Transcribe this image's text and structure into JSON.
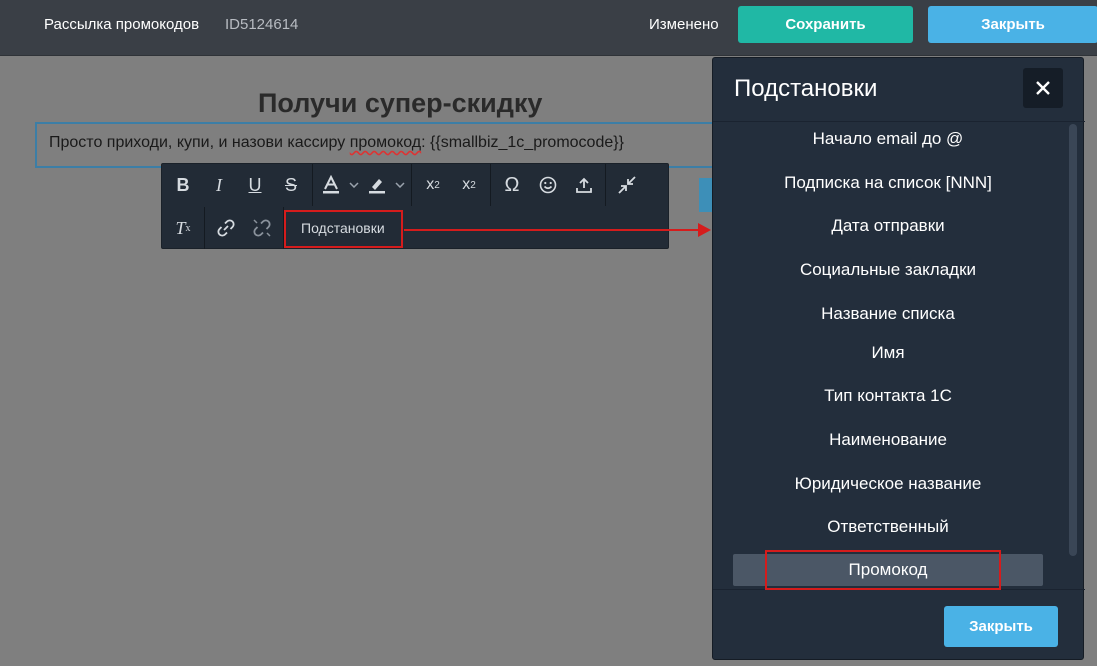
{
  "header": {
    "title": "Рассылка промокодов",
    "id": "ID5124614",
    "status": "Изменено",
    "save_label": "Сохранить",
    "close_label": "Закрыть"
  },
  "editor": {
    "headline": "Получи супер-скидку",
    "text_before": "Просто приходи, купи, и назови кассиру ",
    "text_misspelled": "промокод",
    "text_after": ": {{smallbiz_1c_promocode}}"
  },
  "toolbar": {
    "substitutions_label": "Подстановки"
  },
  "panel": {
    "title": "Подстановки",
    "items": [
      "Начало email до @",
      "Подписка на список [NNN]",
      "Дата отправки",
      "Социальные закладки",
      "Название списка",
      "Имя",
      "Тип контакта 1С",
      "Наименование",
      "Юридическое название",
      "Ответственный",
      "Промокод"
    ],
    "selected_item": "Промокод",
    "close_label": "Закрыть"
  },
  "colors": {
    "header_bg": "#3a3f46",
    "save_button": "#20b8a5",
    "close_button": "#4ab2e6",
    "panel_bg": "#232e3c",
    "toolbar_bg": "#222b36",
    "annotation_red": "#d51c1c",
    "overlay": "#7f7f7f"
  }
}
